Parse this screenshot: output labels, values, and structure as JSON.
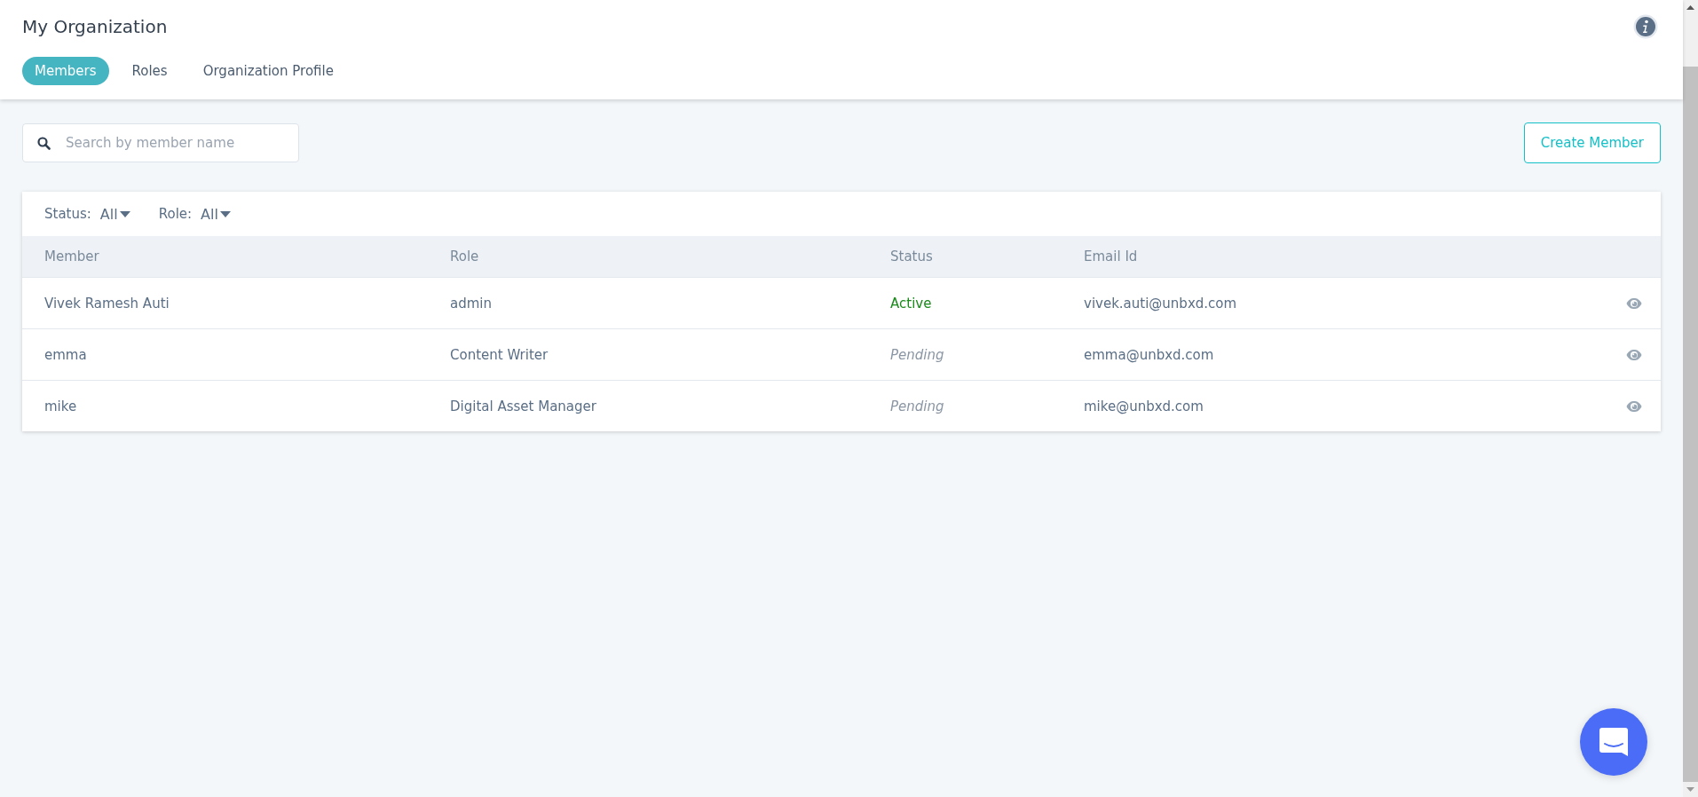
{
  "header": {
    "title": "My Organization"
  },
  "tabs": [
    {
      "label": "Members",
      "selected": true
    },
    {
      "label": "Roles",
      "selected": false
    },
    {
      "label": "Organization Profile",
      "selected": false
    }
  ],
  "search": {
    "placeholder": "Search by member name"
  },
  "create_button": "Create Member",
  "filters": [
    {
      "label": "Status:",
      "value": "All"
    },
    {
      "label": "Role:",
      "value": "All"
    }
  ],
  "table": {
    "columns": [
      "Member",
      "Role",
      "Status",
      "Email Id"
    ],
    "rows": [
      {
        "member": "Vivek Ramesh Auti",
        "role": "admin",
        "status": {
          "text": "Active",
          "kind": "active"
        },
        "email": "vivek.auti@unbxd.com"
      },
      {
        "member": "emma",
        "role": "Content Writer",
        "status": {
          "text": "Pending",
          "kind": "pending"
        },
        "email": "emma@unbxd.com"
      },
      {
        "member": "mike",
        "role": "Digital Asset Manager",
        "status": {
          "text": "Pending",
          "kind": "pending"
        },
        "email": "mike@unbxd.com"
      }
    ]
  }
}
